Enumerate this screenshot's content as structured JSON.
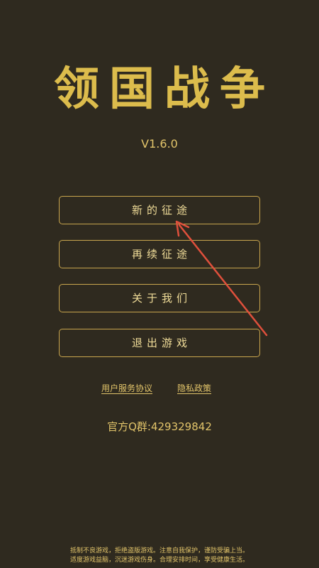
{
  "game": {
    "title": "领国战争",
    "version": "V1.6.0"
  },
  "menu": {
    "new_game": "新的征途",
    "continue": "再续征途",
    "about": "关于我们",
    "exit": "退出游戏"
  },
  "links": {
    "user_agreement": "用户服务协议",
    "privacy_policy": "隐私政策"
  },
  "contact": {
    "qq_group": "官方Q群:429329842"
  },
  "notice": {
    "line1": "抵制不良游戏，拒绝盗版游戏。注意自我保护，谨防受骗上当。",
    "line2": "适度游戏益脑，沉迷游戏伤身。合理安排时间，享受健康生活。"
  },
  "colors": {
    "background": "#2f2a1f",
    "gold": "#dcbc4c",
    "border": "#c9a64e",
    "annotation_arrow": "#e0503c"
  }
}
